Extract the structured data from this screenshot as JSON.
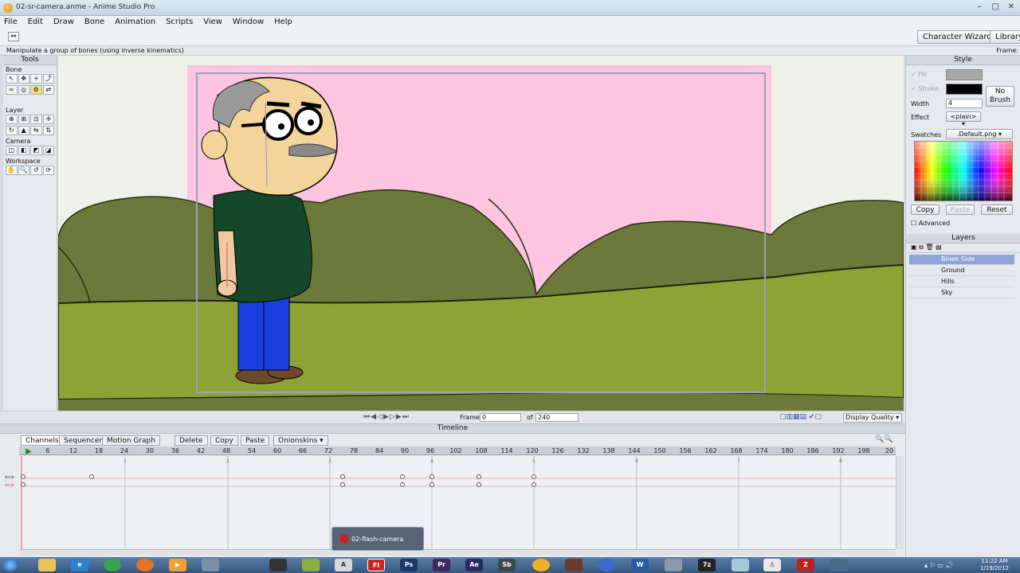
{
  "window": {
    "title": "02-sr-camera.anme - Anime Studio Pro",
    "controls": [
      "–",
      "□",
      "✕"
    ]
  },
  "menu": [
    "File",
    "Edit",
    "Draw",
    "Bone",
    "Animation",
    "Scripts",
    "View",
    "Window",
    "Help"
  ],
  "toolbar": {
    "character_wizard": "Character Wizard",
    "library": "Library"
  },
  "status": {
    "hint": "Manipulate a group of bones (using inverse kinematics)",
    "frame_label": "Frame: "
  },
  "tools": {
    "title": "Tools",
    "sections": [
      "Bone",
      "Layer",
      "Camera",
      "Workspace"
    ]
  },
  "style": {
    "title": "Style",
    "fill_label": "Fill",
    "stroke_label": "Stroke",
    "width_label": "Width",
    "width_value": "4",
    "effect_label": "Effect",
    "effect_value": "<plain>",
    "no_brush": "No Brush",
    "swatches_label": "Swatches",
    "swatches_value": ".Default.png",
    "copy": "Copy",
    "paste": "Paste",
    "reset": "Reset",
    "advanced": "Advanced",
    "fill_color": "#a8a8a8",
    "stroke_color": "#000000"
  },
  "layers": {
    "title": "Layers",
    "items": [
      "Binek Side",
      "Ground",
      "Hills",
      "Sky"
    ]
  },
  "transport": {
    "frame_label": "Frame",
    "frame_value": "0",
    "of_label": "of",
    "total_frames": "240",
    "display_quality": "Display Quality"
  },
  "timeline": {
    "title": "Timeline",
    "tabs": [
      "Channels",
      "Sequencer",
      "Motion Graph"
    ],
    "buttons": [
      "Delete",
      "Copy",
      "Paste"
    ],
    "onionskins": "Onionskins",
    "ruler": [
      "6",
      "12",
      "18",
      "24",
      "30",
      "36",
      "42",
      "48",
      "54",
      "60",
      "66",
      "72",
      "78",
      "84",
      "90",
      "96",
      "102",
      "108",
      "114",
      "120",
      "126",
      "132",
      "138",
      "144",
      "150",
      "156",
      "162",
      "168",
      "174",
      "180",
      "186",
      "192",
      "198",
      "20"
    ],
    "second_markers": [
      "1",
      "2",
      "3",
      "4",
      "5",
      "6",
      "7",
      "8"
    ]
  },
  "taskbar": {
    "preview_label": "02-flash-camera",
    "icon_labels": [
      "Ps",
      "Pr",
      "Ae",
      "Sb",
      "W",
      "7z"
    ],
    "time": "11:22 AM",
    "date": "1/19/2012"
  }
}
